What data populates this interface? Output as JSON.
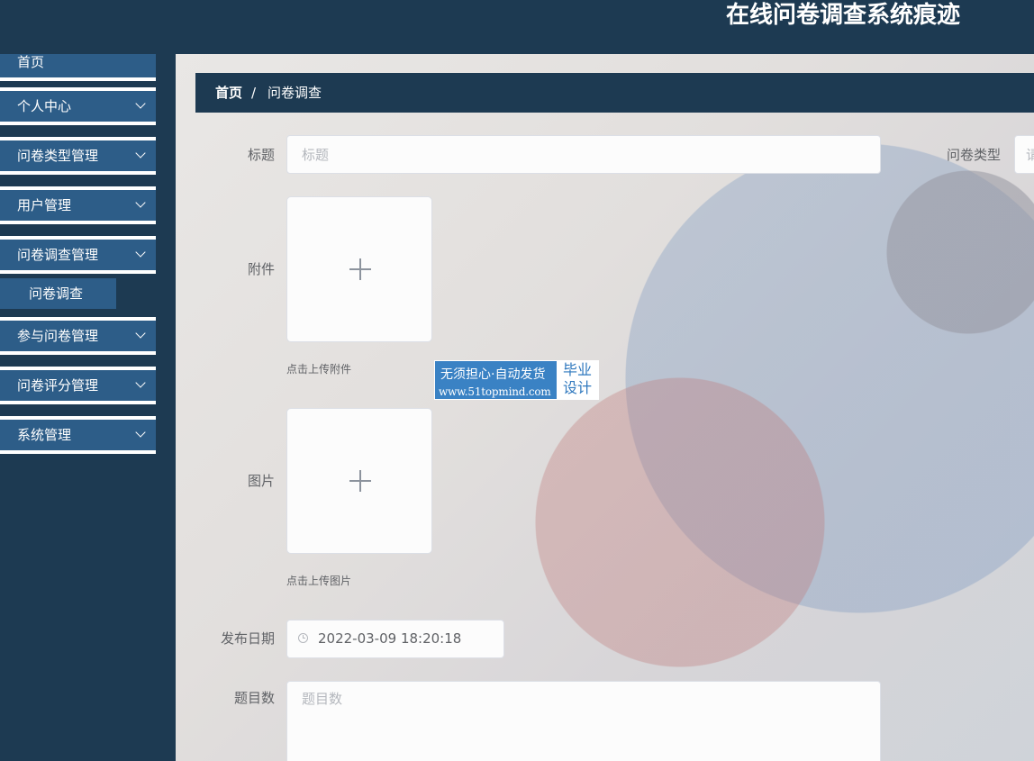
{
  "header": {
    "title": "在线问卷调查系统痕迹"
  },
  "sidebar": {
    "items": [
      {
        "label": "首页"
      },
      {
        "label": "个人中心"
      },
      {
        "label": "问卷类型管理"
      },
      {
        "label": "用户管理"
      },
      {
        "label": "问卷调查管理"
      },
      {
        "label": "参与问卷管理"
      },
      {
        "label": "问卷评分管理"
      },
      {
        "label": "系统管理"
      }
    ],
    "subitem": {
      "label": "问卷调查"
    }
  },
  "breadcrumb": {
    "home": "首页",
    "separator": "/",
    "current": "问卷调查"
  },
  "form": {
    "title": {
      "label": "标题",
      "placeholder": "标题"
    },
    "type": {
      "label": "问卷类型",
      "placeholder": "请"
    },
    "attachment": {
      "label": "附件",
      "hint": "点击上传附件"
    },
    "image": {
      "label": "图片",
      "hint": "点击上传图片"
    },
    "publish_date": {
      "label": "发布日期",
      "value": "2022-03-09 18:20:18"
    },
    "question_count": {
      "label": "题目数",
      "placeholder": "题目数"
    }
  },
  "watermark": {
    "line1": "无须担心·自动发货",
    "line2": "www.51topmind.com",
    "badge_line1": "毕业",
    "badge_line2": "设计"
  },
  "colors": {
    "nav_bg": "#1d3a52",
    "menu_bg": "#2d5d88",
    "watermark_bg": "#3a82c4"
  }
}
